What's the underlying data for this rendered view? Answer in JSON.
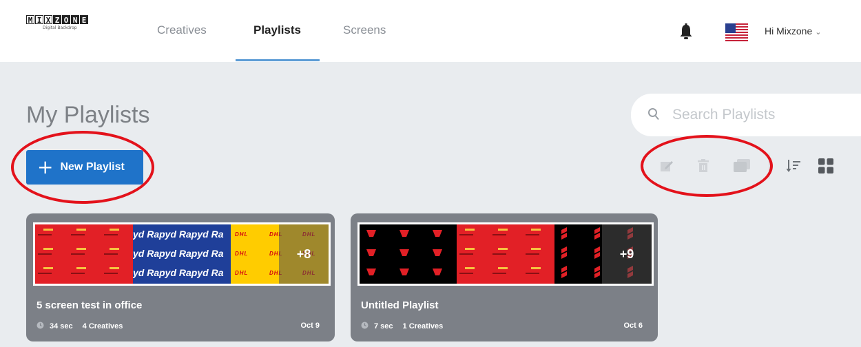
{
  "brand": {
    "logo_letters": [
      "M",
      "I",
      "X",
      "Z",
      "O",
      "N",
      "E"
    ],
    "logo_tagline": "Digital Backdrop"
  },
  "nav": {
    "tabs": [
      {
        "label": "Creatives",
        "active": false
      },
      {
        "label": "Playlists",
        "active": true
      },
      {
        "label": "Screens",
        "active": false
      }
    ]
  },
  "header": {
    "greeting": "Hi Mixzone",
    "notification_icon": "bell-icon",
    "language_icon": "us-flag-icon",
    "dropdown_icon": "chevron-down-icon"
  },
  "page": {
    "title": "My Playlists"
  },
  "search": {
    "placeholder": "Search Playlists",
    "value": ""
  },
  "actions": {
    "new_playlist_label": "New Playlist"
  },
  "toolbar": {
    "icons": [
      "edit-icon",
      "trash-icon",
      "duplicate-icon",
      "sort-icon",
      "grid-view-icon"
    ]
  },
  "playlists": [
    {
      "title": "5 screen test in office",
      "duration": "34 sec",
      "creatives": "4 Creatives",
      "date": "Oct 9",
      "more_count": "+8",
      "thumbnails": [
        "red-logo-pattern",
        "rapyd-banner",
        "dhl-banner"
      ]
    },
    {
      "title": "Untitled Playlist",
      "duration": "7 sec",
      "creatives": "1 Creatives",
      "date": "Oct 6",
      "more_count": "+9",
      "thumbnails": [
        "black-logo-pattern",
        "red-logo-pattern",
        "suzuki-pattern"
      ]
    }
  ],
  "thumb_text": {
    "rapyd": "yd Rapyd Rapyd Ra",
    "dhl": "DHL"
  },
  "colors": {
    "primary_button": "#1f73c9",
    "card_bg": "#7c8087",
    "annotation": "#e3121b",
    "active_tab_underline": "#5b9bd5"
  }
}
